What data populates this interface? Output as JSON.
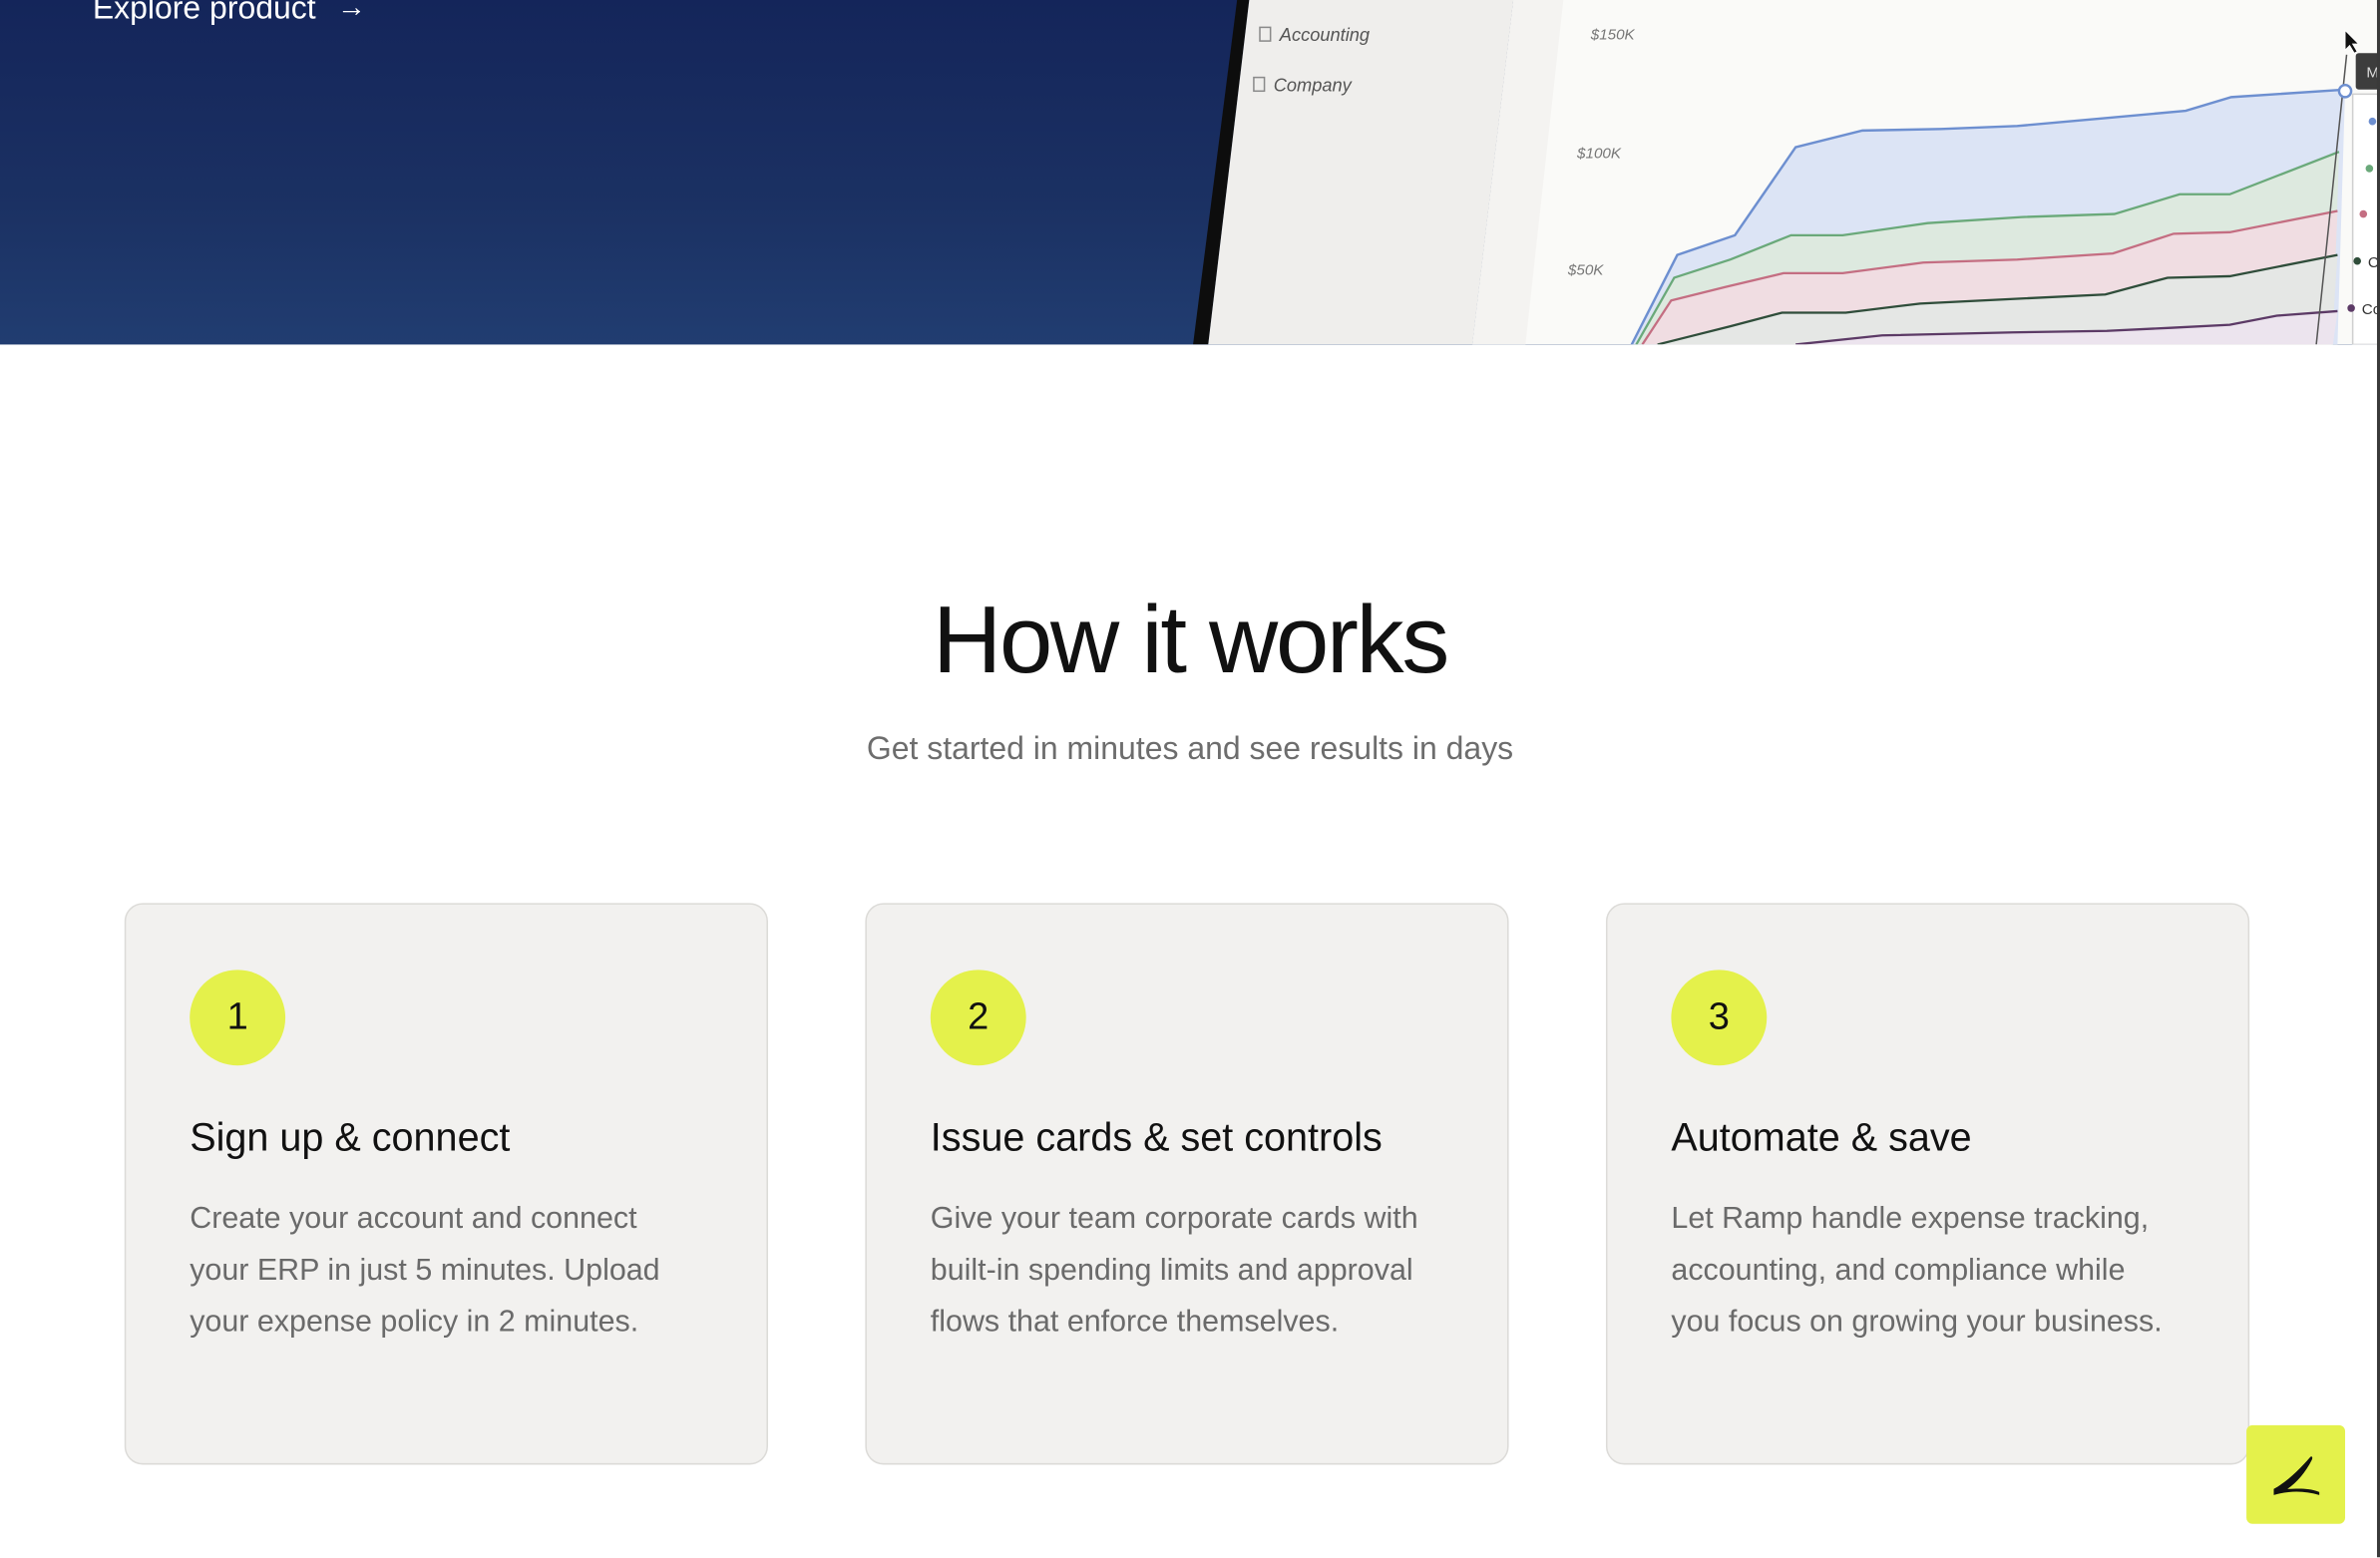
{
  "hero": {
    "explore_label": "Explore product",
    "explore_arrow": "→",
    "sidebar_items": [
      "Accounting",
      "Company"
    ],
    "chart_ticks": [
      "$150K",
      "$100K",
      "$50K"
    ],
    "tooltip_partial": "M",
    "legend_partial": [
      "C",
      "Co"
    ]
  },
  "section": {
    "title": "How it works",
    "subtitle": "Get started in minutes and see results in days"
  },
  "steps": [
    {
      "number": "1",
      "title": "Sign up & connect",
      "body": "Create your account and connect your ERP in just 5 minutes. Upload your expense policy in 2 minutes."
    },
    {
      "number": "2",
      "title": "Issue cards & set controls",
      "body": "Give your team corporate cards with built-in spending limits and approval flows that enforce themselves."
    },
    {
      "number": "3",
      "title": "Automate & save",
      "body": "Let Ramp handle expense tracking, accounting, and compliance while you focus on growing your business."
    }
  ],
  "colors": {
    "accent": "#e4f14b",
    "hero_top": "#14255a",
    "hero_bottom": "#213d71",
    "card_bg": "#f2f1ef"
  },
  "icons": {
    "explore_arrow": "arrow-right-icon",
    "chat_button": "ramp-logo-icon"
  }
}
